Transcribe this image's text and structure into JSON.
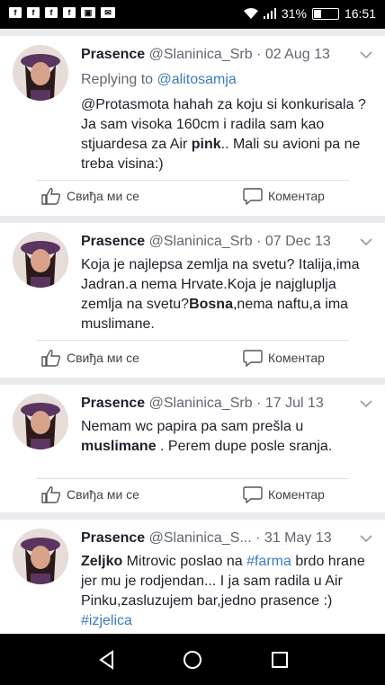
{
  "status": {
    "battery": "31%",
    "battery_level": 0.31,
    "time": "16:51"
  },
  "posts": [
    {
      "name": "Prasence",
      "handle": "@Slaninica_Srb",
      "date": "· 02 Aug 13",
      "replying_prefix": "Replying to ",
      "replying_handle": "@alitosamja",
      "text_a": "@Protasmota hahah za koju si konkurisala ? Ja sam visoka 160cm i radila sam kao stjuardesa za Air ",
      "text_bold": "pink",
      "text_b": ".. Mali su avioni pa ne treba visina:)",
      "like": "Свиђа ми се",
      "comment": "Коментар"
    },
    {
      "name": "Prasence",
      "handle": "@Slaninica_Srb",
      "date": "· 07 Dec 13",
      "text_a": "Koja je najlepsa zemlja na svetu? Italija,ima Jadran.a nema Hrvate.Koja je najgluplja zemlja na svetu?",
      "text_bold": "Bosna",
      "text_b": ",nema naftu,a ima muslimane.",
      "like": "Свиђа ми се",
      "comment": "Коментар"
    },
    {
      "name": "Prasence",
      "handle": "@Slaninica_Srb",
      "date": "· 17 Jul 13",
      "text_a": "Nemam wc papira pa sam prešla u ",
      "text_bold": "muslimane",
      "text_b": " . Perem dupe posle sranja.",
      "like": "Свиђа ми се",
      "comment": "Коментар"
    },
    {
      "name": "Prasence",
      "handle": "@Slaninica_S...",
      "date": "· 31 May 13",
      "text_bold": "Zeljko",
      "text_a": " Mitrovic poslao na ",
      "tag1": "#farma",
      "text_b": " brdo hrane jer mu je rodjendan... I ja sam radila u Air Pinku,zasluzujem bar,jedno prasence :) ",
      "tag2": "#izjelica"
    }
  ],
  "colors": {
    "link": "#3b7bbf",
    "background": "#e9ebee"
  }
}
